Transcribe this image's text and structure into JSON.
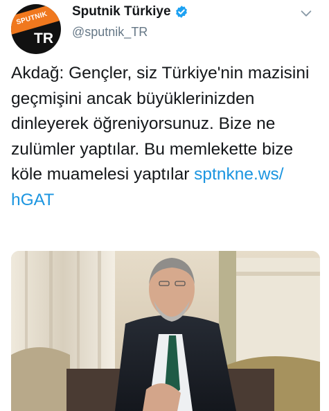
{
  "account": {
    "display_name": "Sputnik Türkiye",
    "handle": "@sputnik_TR",
    "verified": true,
    "avatar": {
      "logo_text": "SPUTNIK",
      "badge_text": "TR",
      "band_color": "#f0781e"
    }
  },
  "menu_icon": "chevron-down-icon",
  "tweet": {
    "text": "Akdağ: Gençler, siz Türkiye'nin mazisini geçmişini ancak büyüklerinizden  dinleyerek öğreniyorsunuz. Bize ne zulümler yaptılar. Bu memlekette bize köle muamelesi yaptılar ",
    "link_text": "sptnkne.ws/\nhGAT"
  },
  "media": {
    "kind": "photo",
    "alt": ""
  },
  "colors": {
    "link": "#1b95e0",
    "verified": "#1da1f2",
    "handle": "#657786",
    "text": "#14171a"
  }
}
